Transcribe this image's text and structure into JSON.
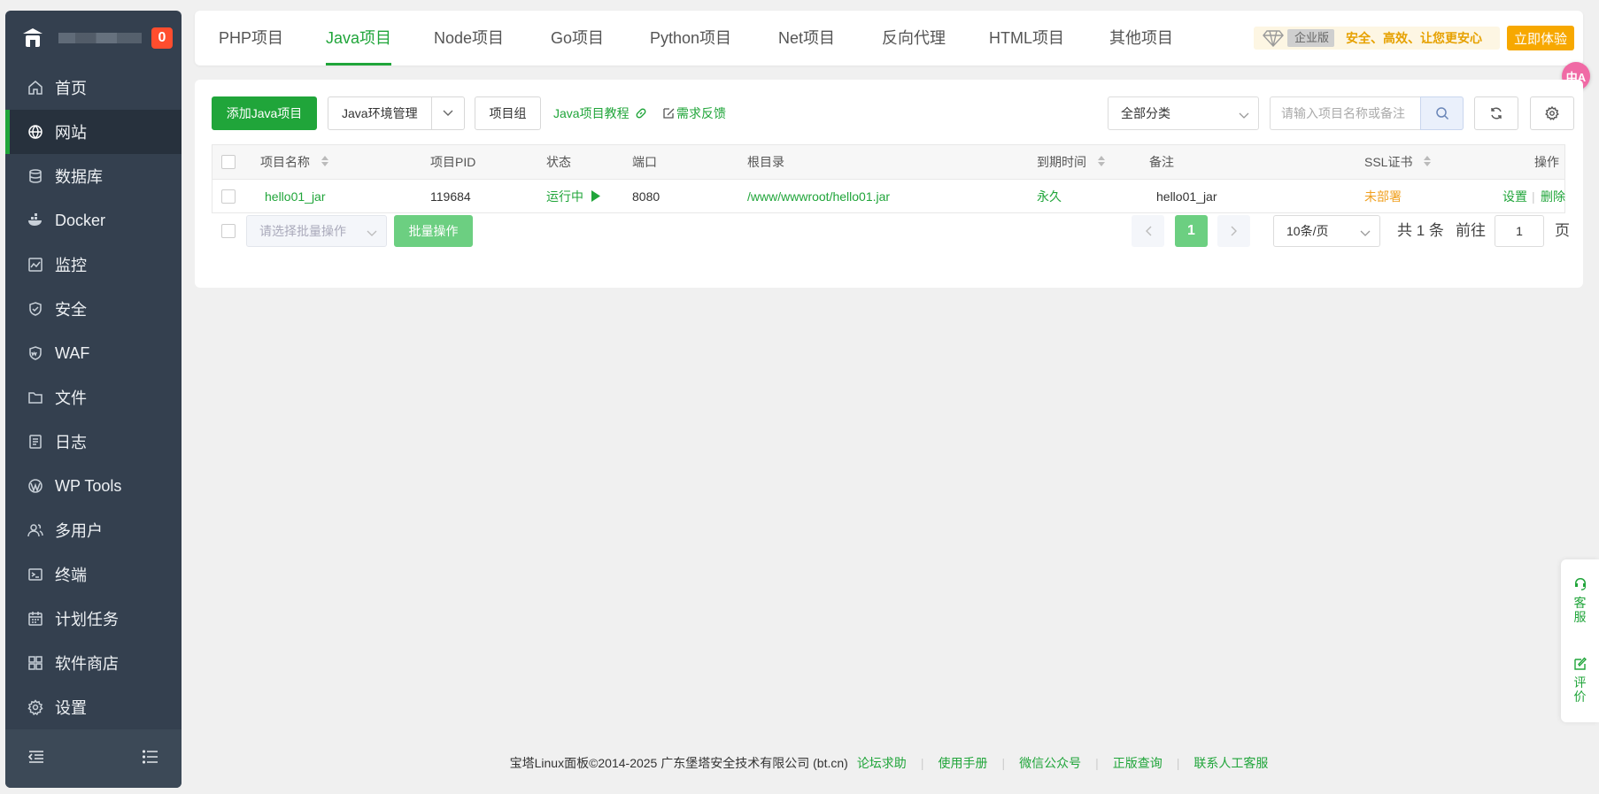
{
  "sidebar": {
    "badge": "0",
    "items": [
      {
        "label": "首页",
        "icon": "home-icon"
      },
      {
        "label": "网站",
        "icon": "globe-icon",
        "active": true
      },
      {
        "label": "数据库",
        "icon": "database-icon"
      },
      {
        "label": "Docker",
        "icon": "docker-icon"
      },
      {
        "label": "监控",
        "icon": "monitor-icon"
      },
      {
        "label": "安全",
        "icon": "shield-icon"
      },
      {
        "label": "WAF",
        "icon": "waf-icon"
      },
      {
        "label": "文件",
        "icon": "folder-icon"
      },
      {
        "label": "日志",
        "icon": "log-icon"
      },
      {
        "label": "WP Tools",
        "icon": "wordpress-icon"
      },
      {
        "label": "多用户",
        "icon": "users-icon"
      },
      {
        "label": "终端",
        "icon": "terminal-icon"
      },
      {
        "label": "计划任务",
        "icon": "calendar-icon"
      },
      {
        "label": "软件商店",
        "icon": "apps-icon"
      },
      {
        "label": "设置",
        "icon": "gear-icon"
      }
    ]
  },
  "tabs": [
    {
      "label": "PHP项目"
    },
    {
      "label": "Java项目",
      "active": true
    },
    {
      "label": "Node项目"
    },
    {
      "label": "Go项目"
    },
    {
      "label": "Python项目"
    },
    {
      "label": "Net项目"
    },
    {
      "label": "反向代理"
    },
    {
      "label": "HTML项目"
    },
    {
      "label": "其他项目"
    }
  ],
  "promo": {
    "edition": "企业版",
    "slogan": "安全、高效、让您更安心",
    "try_label": "立即体验"
  },
  "toolbar": {
    "add_label": "添加Java项目",
    "env_label": "Java环境管理",
    "group_label": "项目组",
    "tutorial_label": "Java项目教程",
    "feedback_label": "需求反馈",
    "category_value": "全部分类",
    "search_placeholder": "请输入项目名称或备注"
  },
  "table": {
    "headers": {
      "name": "项目名称",
      "pid": "项目PID",
      "status": "状态",
      "port": "端口",
      "root": "根目录",
      "expire": "到期时间",
      "remark": "备注",
      "ssl": "SSL证书",
      "ops": "操作"
    },
    "rows": [
      {
        "name": "hello01_jar",
        "pid": "119684",
        "status": "运行中",
        "port": "8080",
        "root": "/www/wwwroot/hello01.jar",
        "expire": "永久",
        "remark": "hello01_jar",
        "ssl": "未部署",
        "op_settings": "设置",
        "op_delete": "删除"
      }
    ]
  },
  "bulk": {
    "select_placeholder": "请选择批量操作",
    "button": "批量操作"
  },
  "pagination": {
    "current_page": "1",
    "page_size": "10条/页",
    "total_text": "共 1 条",
    "goto_label": "前往",
    "goto_value": "1",
    "page_unit": "页"
  },
  "footer": {
    "copyright": "宝塔Linux面板©2014-2025 广东堡塔安全技术有限公司 (bt.cn)",
    "links": [
      "论坛求助",
      "使用手册",
      "微信公众号",
      "正版查询",
      "联系人工客服"
    ]
  },
  "float": {
    "lang_icon": "中A",
    "service": "客服",
    "review": "评价"
  },
  "colors": {
    "accent": "#20a53a",
    "sidebar": "#34404f",
    "warning": "#f0a020"
  }
}
